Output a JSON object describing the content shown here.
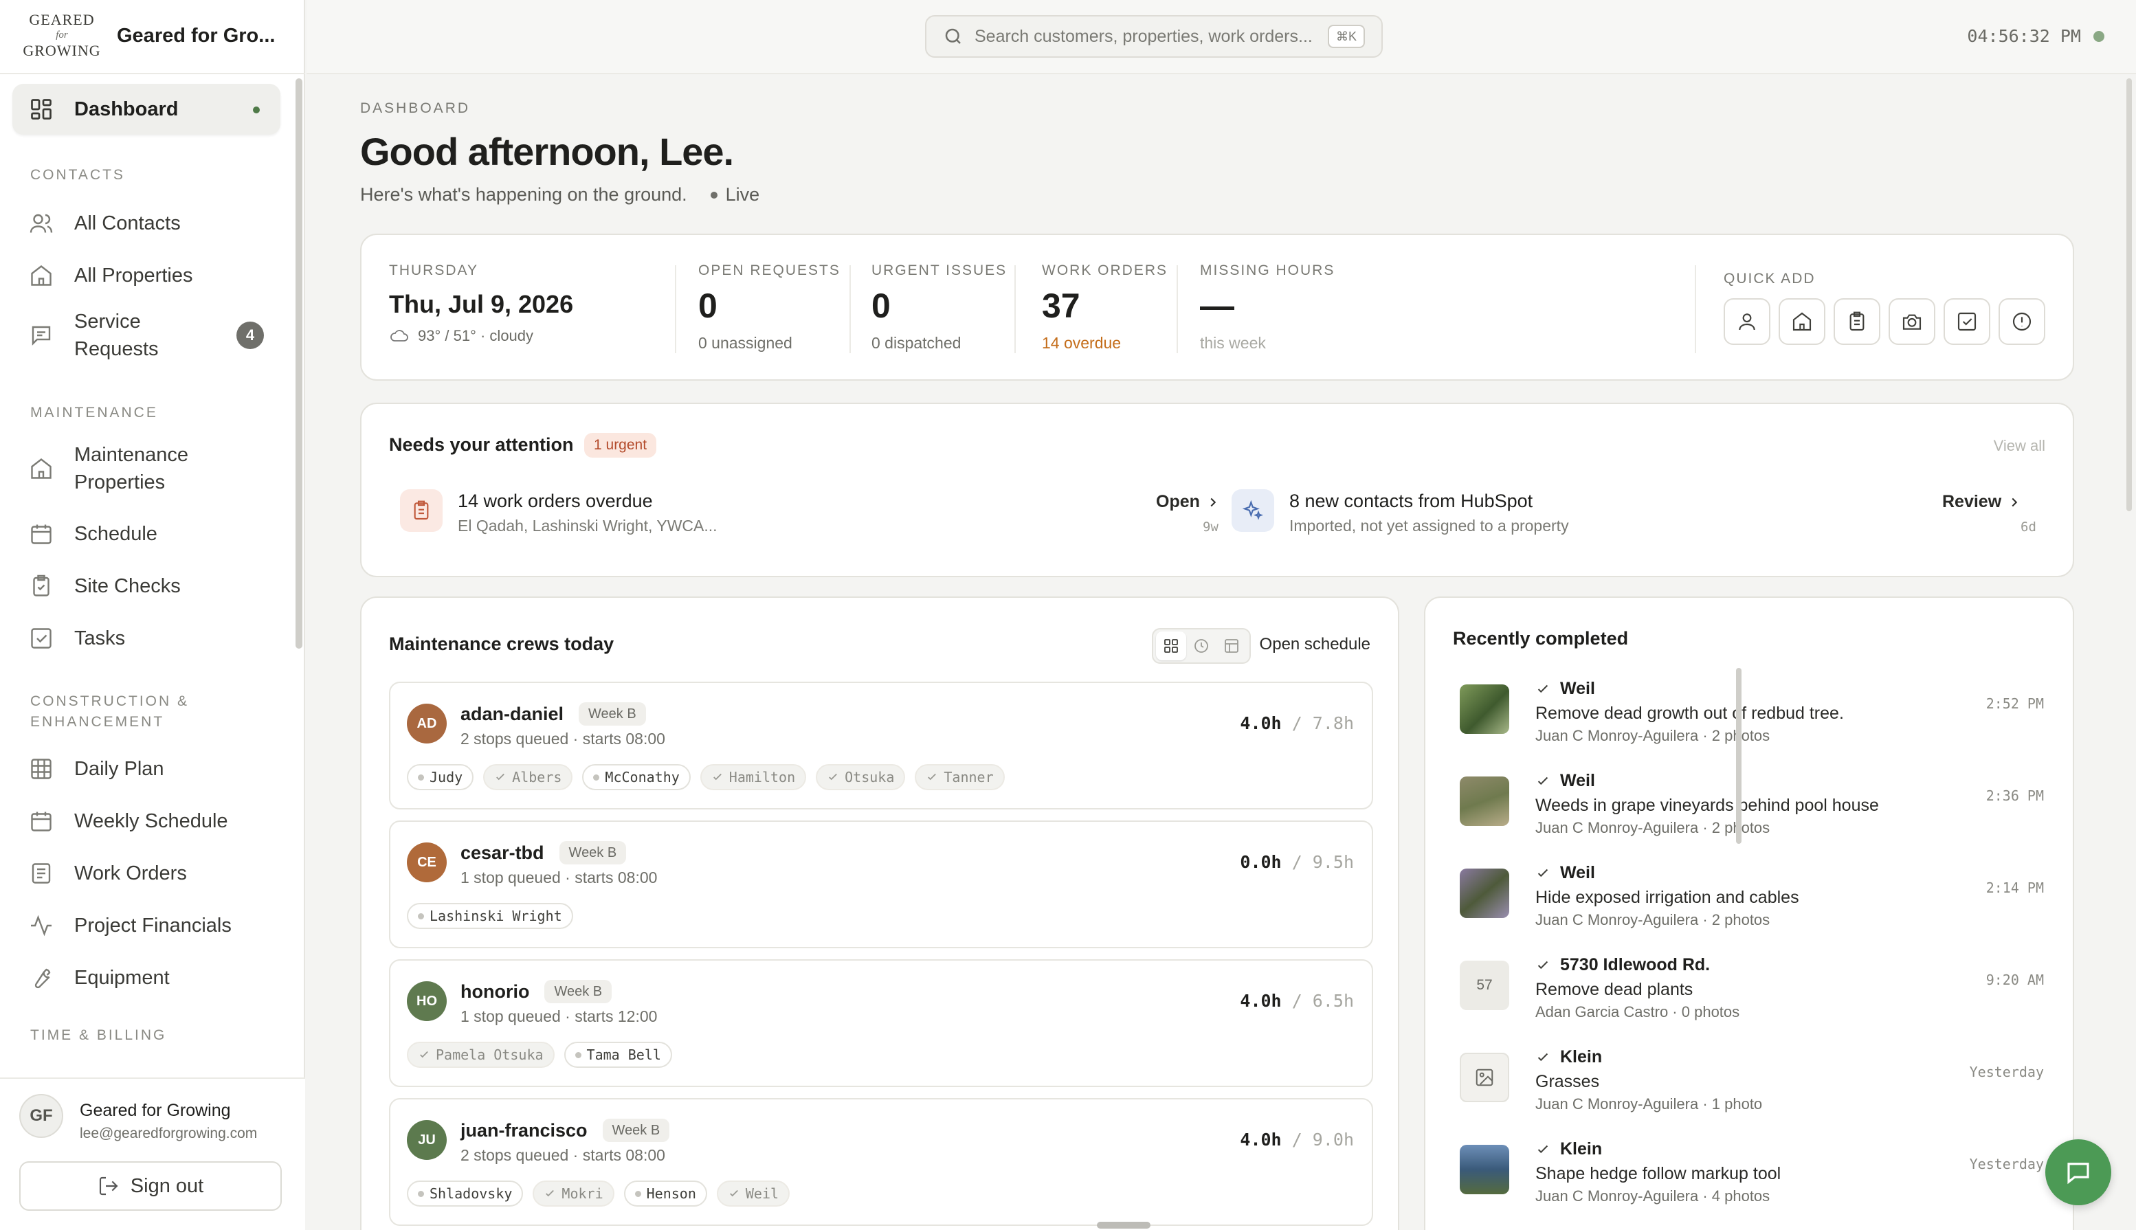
{
  "brand": {
    "logo_line1": "GEARED",
    "logo_line2": "for",
    "logo_line3": "GROWING",
    "name": "Geared for Gro..."
  },
  "sidebar": {
    "dashboard": "Dashboard",
    "contacts_section": "CONTACTS",
    "all_contacts": "All Contacts",
    "all_properties": "All Properties",
    "service_requests": "Service Requests",
    "service_requests_badge": "4",
    "maintenance_section": "MAINTENANCE",
    "maintenance_properties": "Maintenance Properties",
    "schedule": "Schedule",
    "site_checks": "Site Checks",
    "tasks": "Tasks",
    "construction_section": "CONSTRUCTION & ENHANCEMENT",
    "daily_plan": "Daily Plan",
    "weekly_schedule": "Weekly Schedule",
    "work_orders": "Work Orders",
    "project_financials": "Project Financials",
    "equipment": "Equipment",
    "time_section": "TIME & BILLING"
  },
  "account": {
    "initials": "GF",
    "name": "Geared for Growing",
    "email": "lee@gearedforgrowing.com",
    "signout": "Sign out"
  },
  "topbar": {
    "search_placeholder": "Search customers, properties, work orders...",
    "shortcut": "⌘K",
    "clock": "04:56:32 PM"
  },
  "page": {
    "breadcrumb": "DASHBOARD",
    "greeting": "Good afternoon, Lee.",
    "subtitle": "Here's what's happening on the ground.",
    "live": "Live"
  },
  "stats": {
    "day_label": "THURSDAY",
    "date": "Thu, Jul 9, 2026",
    "weather": "93° / 51° · cloudy",
    "open_requests_label": "OPEN REQUESTS",
    "open_requests_value": "0",
    "open_requests_sub": "0 unassigned",
    "urgent_label": "URGENT ISSUES",
    "urgent_value": "0",
    "urgent_sub": "0 dispatched",
    "wo_label": "WORK ORDERS",
    "wo_value": "37",
    "wo_sub": "14 overdue",
    "missing_label": "MISSING HOURS",
    "missing_value": "—",
    "missing_sub": "this week",
    "quick_add_label": "QUICK ADD"
  },
  "attention": {
    "title": "Needs your attention",
    "badge": "1 urgent",
    "view_all": "View all",
    "items": [
      {
        "title": "14 work orders overdue",
        "sub": "El Qadah, Lashinski Wright, YWCA...",
        "action": "Open",
        "age": "9w"
      },
      {
        "title": "8 new contacts from HubSpot",
        "sub": "Imported, not yet assigned to a property",
        "action": "Review",
        "age": "6d"
      }
    ]
  },
  "crews": {
    "title": "Maintenance crews today",
    "open_schedule": "Open schedule",
    "list": [
      {
        "initials": "AD",
        "name": "adan-daniel",
        "week": "Week B",
        "meta": "2 stops queued · starts 08:00",
        "hours": "4.0h",
        "total": "/ 7.8h",
        "stops": [
          "Judy",
          "Albers",
          "McConathy",
          "Hamilton",
          "Otsuka",
          "Tanner"
        ]
      },
      {
        "initials": "CE",
        "name": "cesar-tbd",
        "week": "Week B",
        "meta": "1 stop queued · starts 08:00",
        "hours": "0.0h",
        "total": "/ 9.5h",
        "stops": [
          "Lashinski Wright"
        ]
      },
      {
        "initials": "HO",
        "name": "honorio",
        "week": "Week B",
        "meta": "1 stop queued · starts 12:00",
        "hours": "4.0h",
        "total": "/ 6.5h",
        "stops": [
          "Pamela Otsuka",
          "Tama Bell"
        ]
      },
      {
        "initials": "JU",
        "name": "juan-francisco",
        "week": "Week B",
        "meta": "2 stops queued · starts 08:00",
        "hours": "4.0h",
        "total": "/ 9.0h",
        "stops": [
          "Shladovsky",
          "Mokri",
          "Henson",
          "Weil"
        ]
      }
    ]
  },
  "recent": {
    "title": "Recently completed",
    "items": [
      {
        "property": "Weil",
        "task": "Remove dead growth out of redbud tree.",
        "who": "Juan C Monroy-Aguilera · 2 photos",
        "time": "2:52 PM"
      },
      {
        "property": "Weil",
        "task": "Weeds in grape vineyards behind pool house",
        "who": "Juan C Monroy-Aguilera · 2 photos",
        "time": "2:36 PM"
      },
      {
        "property": "Weil",
        "task": "Hide exposed irrigation and cables",
        "who": "Juan C Monroy-Aguilera · 2 photos",
        "time": "2:14 PM"
      },
      {
        "property": "5730 Idlewood Rd.",
        "task": "Remove dead plants",
        "who": "Adan Garcia Castro · 0 photos",
        "time": "9:20 AM",
        "thumb_text": "57"
      },
      {
        "property": "Klein",
        "task": "Grasses",
        "who": "Juan C Monroy-Aguilera · 1 photo",
        "time": "Yesterday"
      },
      {
        "property": "Klein",
        "task": "Shape hedge follow markup tool",
        "who": "Juan C Monroy-Aguilera · 4 photos",
        "time": "Yesterday"
      }
    ]
  },
  "colors": {
    "accent_green": "#4c9a55",
    "warning": "#c46d1a",
    "urgent": "#b34a2a"
  }
}
